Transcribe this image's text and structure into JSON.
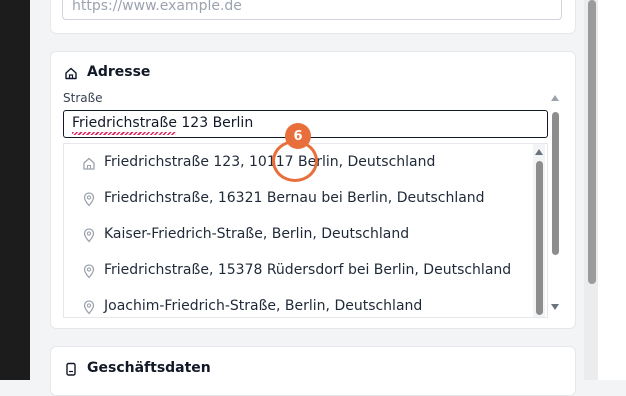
{
  "website": {
    "placeholder": "https://www.example.de"
  },
  "address_section": {
    "title": "Adresse",
    "icon": "house-icon",
    "street_label": "Straße",
    "street_value": "Friedrichstraße 123 Berlin"
  },
  "suggestions": [
    {
      "icon": "house-icon",
      "text": "Friedrichstraße 123, 10117 Berlin, Deutschland"
    },
    {
      "icon": "map-pin-icon",
      "text": "Friedrichstraße, 16321 Bernau bei Berlin, Deutschland"
    },
    {
      "icon": "map-pin-icon",
      "text": "Kaiser-Friedrich-Straße, Berlin, Deutschland"
    },
    {
      "icon": "map-pin-icon",
      "text": "Friedrichstraße, 15378 Rüdersdorf bei Berlin, Deutschland"
    },
    {
      "icon": "map-pin-icon",
      "text": "Joachim-Friedrich-Straße, Berlin, Deutschland"
    }
  ],
  "business_section": {
    "title": "Geschäftsdaten",
    "icon": "receipt-icon"
  },
  "annotation": {
    "badge": "6"
  },
  "colors": {
    "accent": "#e86f3c",
    "spellcheck": "#e0245e",
    "input_border": "#111827"
  }
}
